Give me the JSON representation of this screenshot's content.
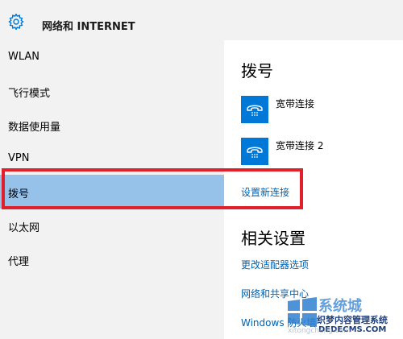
{
  "header": {
    "title": "网络和 INTERNET",
    "icon": "gear-icon"
  },
  "sidebar": {
    "items": [
      {
        "label": "WLAN",
        "selected": false
      },
      {
        "label": "飞行模式",
        "selected": false
      },
      {
        "label": "数据使用量",
        "selected": false
      },
      {
        "label": "VPN",
        "selected": false
      },
      {
        "label": "拨号",
        "selected": true
      },
      {
        "label": "以太网",
        "selected": false
      },
      {
        "label": "代理",
        "selected": false
      }
    ]
  },
  "main": {
    "section_title": "拨号",
    "connections": [
      {
        "label": "宽带连接",
        "icon": "dialup-phone-icon"
      },
      {
        "label": "宽带连接 2",
        "icon": "dialup-phone-icon"
      }
    ],
    "new_connection_link": "设置新连接",
    "related_title": "相关设置",
    "related_links": [
      "更改适配器选项",
      "网络和共享中心",
      "Windows 防火墙"
    ]
  },
  "watermark": {
    "site_name": "系统城",
    "subtitle": "织梦内容管理系统",
    "domain": "DEDECMS.COM",
    "faint_text": "xitongcheng.com"
  },
  "colors": {
    "accent": "#0078d7",
    "link": "#0063b1",
    "selected_bg": "#96c2ea",
    "sidebar_bg": "#f2f2f2",
    "annotation_red": "#e0202a"
  }
}
